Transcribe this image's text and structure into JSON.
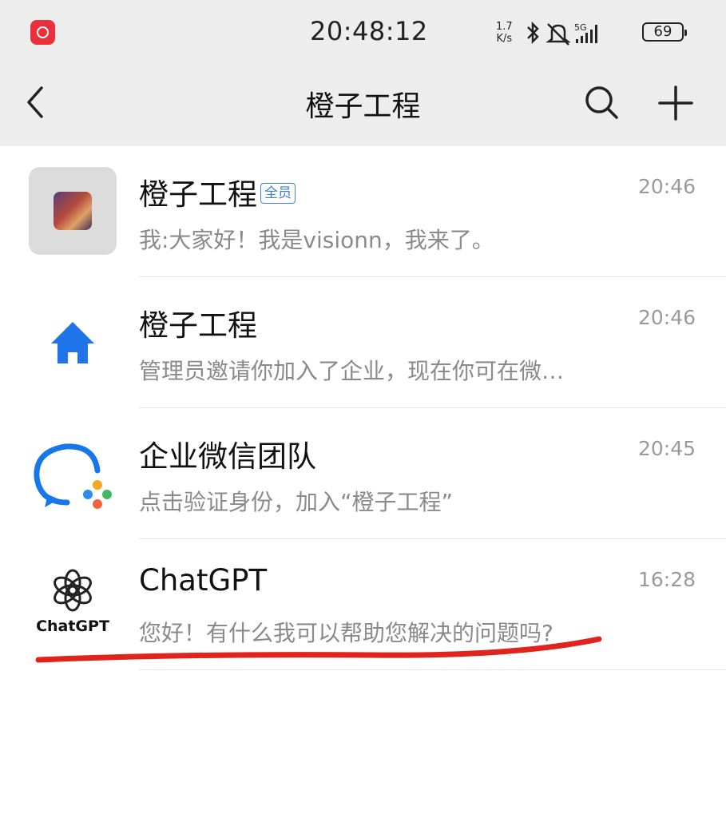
{
  "status_bar": {
    "time": "20:48:12",
    "net_speed_value": "1.7",
    "net_speed_unit": "K/s",
    "signal_label": "5G",
    "battery": "69"
  },
  "header": {
    "title": "橙子工程"
  },
  "conversations": [
    {
      "name": "橙子工程",
      "badge": "全员",
      "preview": "我:大家好！我是visionn，我来了。",
      "time": "20:46"
    },
    {
      "name": "橙子工程",
      "preview": "管理员邀请你加入了企业，现在你可在微…",
      "time": "20:46"
    },
    {
      "name": "企业微信团队",
      "preview": "点击验证身份，加入“橙子工程”",
      "time": "20:45"
    },
    {
      "name": "ChatGPT",
      "avatar_label": "ChatGPT",
      "preview": "您好！有什么我可以帮助您解决的问题吗?",
      "time": "16:28"
    }
  ],
  "colors": {
    "header_bg": "#ededed",
    "home_icon": "#1e74e8",
    "annotation_stroke": "#e0231c"
  }
}
